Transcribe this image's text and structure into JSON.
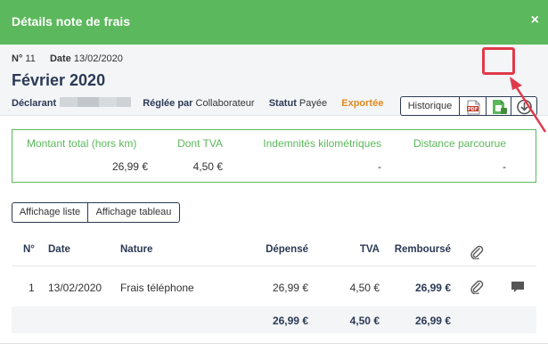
{
  "header": {
    "title": "Détails note de frais",
    "close_label": "×"
  },
  "info": {
    "number_label": "N°",
    "number": "11",
    "date_label": "Date",
    "date": "13/02/2020",
    "month": "Février 2020",
    "declarant_label": "Déclarant",
    "settled_by_label": "Réglée par",
    "settled_by": "Collaborateur",
    "status_label": "Statut",
    "status": "Payée",
    "exported": "Exportée",
    "exported_color": "#e08a1e"
  },
  "toolbar": {
    "history_label": "Historique",
    "pdf_icon": "pdf-file-icon",
    "excel_icon": "excel-export-icon",
    "download_icon": "download-icon"
  },
  "summary": {
    "total_label": "Montant total (hors km)",
    "total_value": "26,99 €",
    "vat_label": "Dont TVA",
    "vat_value": "4,50 €",
    "mileage_label": "Indemnités kilométriques",
    "mileage_value": "-",
    "distance_label": "Distance parcourue",
    "distance_value": "-"
  },
  "view_toggle": {
    "list_label": "Affichage liste",
    "table_label": "Affichage tableau"
  },
  "table": {
    "headers": {
      "num": "N°",
      "date": "Date",
      "nature": "Nature",
      "spent": "Dépensé",
      "vat": "TVA",
      "reimbursed": "Remboursé"
    },
    "rows": [
      {
        "num": "1",
        "date": "13/02/2020",
        "nature": "Frais téléphone",
        "spent": "26,99 €",
        "vat": "4,50 €",
        "reimbursed": "26,99 €"
      }
    ],
    "totals": {
      "spent": "26,99 €",
      "vat": "4,50 €",
      "reimbursed": "26,99 €"
    }
  },
  "colors": {
    "accent": "#5cb85c",
    "navy": "#2b3a55",
    "highlight": "#e03a4a"
  }
}
